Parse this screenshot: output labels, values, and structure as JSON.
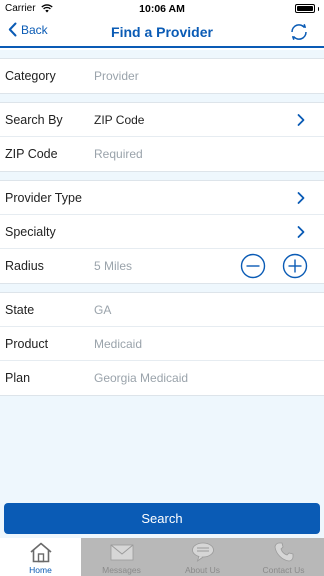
{
  "status": {
    "carrier": "Carrier",
    "time": "10:06 AM"
  },
  "nav": {
    "back_label": "Back",
    "title": "Find a Provider"
  },
  "form": {
    "category": {
      "label": "Category",
      "value": "Provider"
    },
    "search_by": {
      "label": "Search By",
      "value": "ZIP Code"
    },
    "zip_code": {
      "label": "ZIP Code",
      "placeholder": "Required"
    },
    "provider_type": {
      "label": "Provider Type"
    },
    "specialty": {
      "label": "Specialty"
    },
    "radius": {
      "label": "Radius",
      "value": "5 Miles"
    },
    "state": {
      "label": "State",
      "value": "GA"
    },
    "product": {
      "label": "Product",
      "value": "Medicaid"
    },
    "plan": {
      "label": "Plan",
      "value": "Georgia Medicaid"
    }
  },
  "search_button": "Search",
  "tabs": [
    {
      "label": "Home",
      "icon": "home-icon",
      "active": true
    },
    {
      "label": "Messages",
      "icon": "envelope-icon",
      "active": false
    },
    {
      "label": "About Us",
      "icon": "chat-bubble-icon",
      "active": false
    },
    {
      "label": "Contact Us",
      "icon": "phone-icon",
      "active": false
    }
  ],
  "colors": {
    "accent": "#0a5bb5",
    "form_background": "#eef7fd",
    "tab_bar": "#b8b8b8"
  }
}
